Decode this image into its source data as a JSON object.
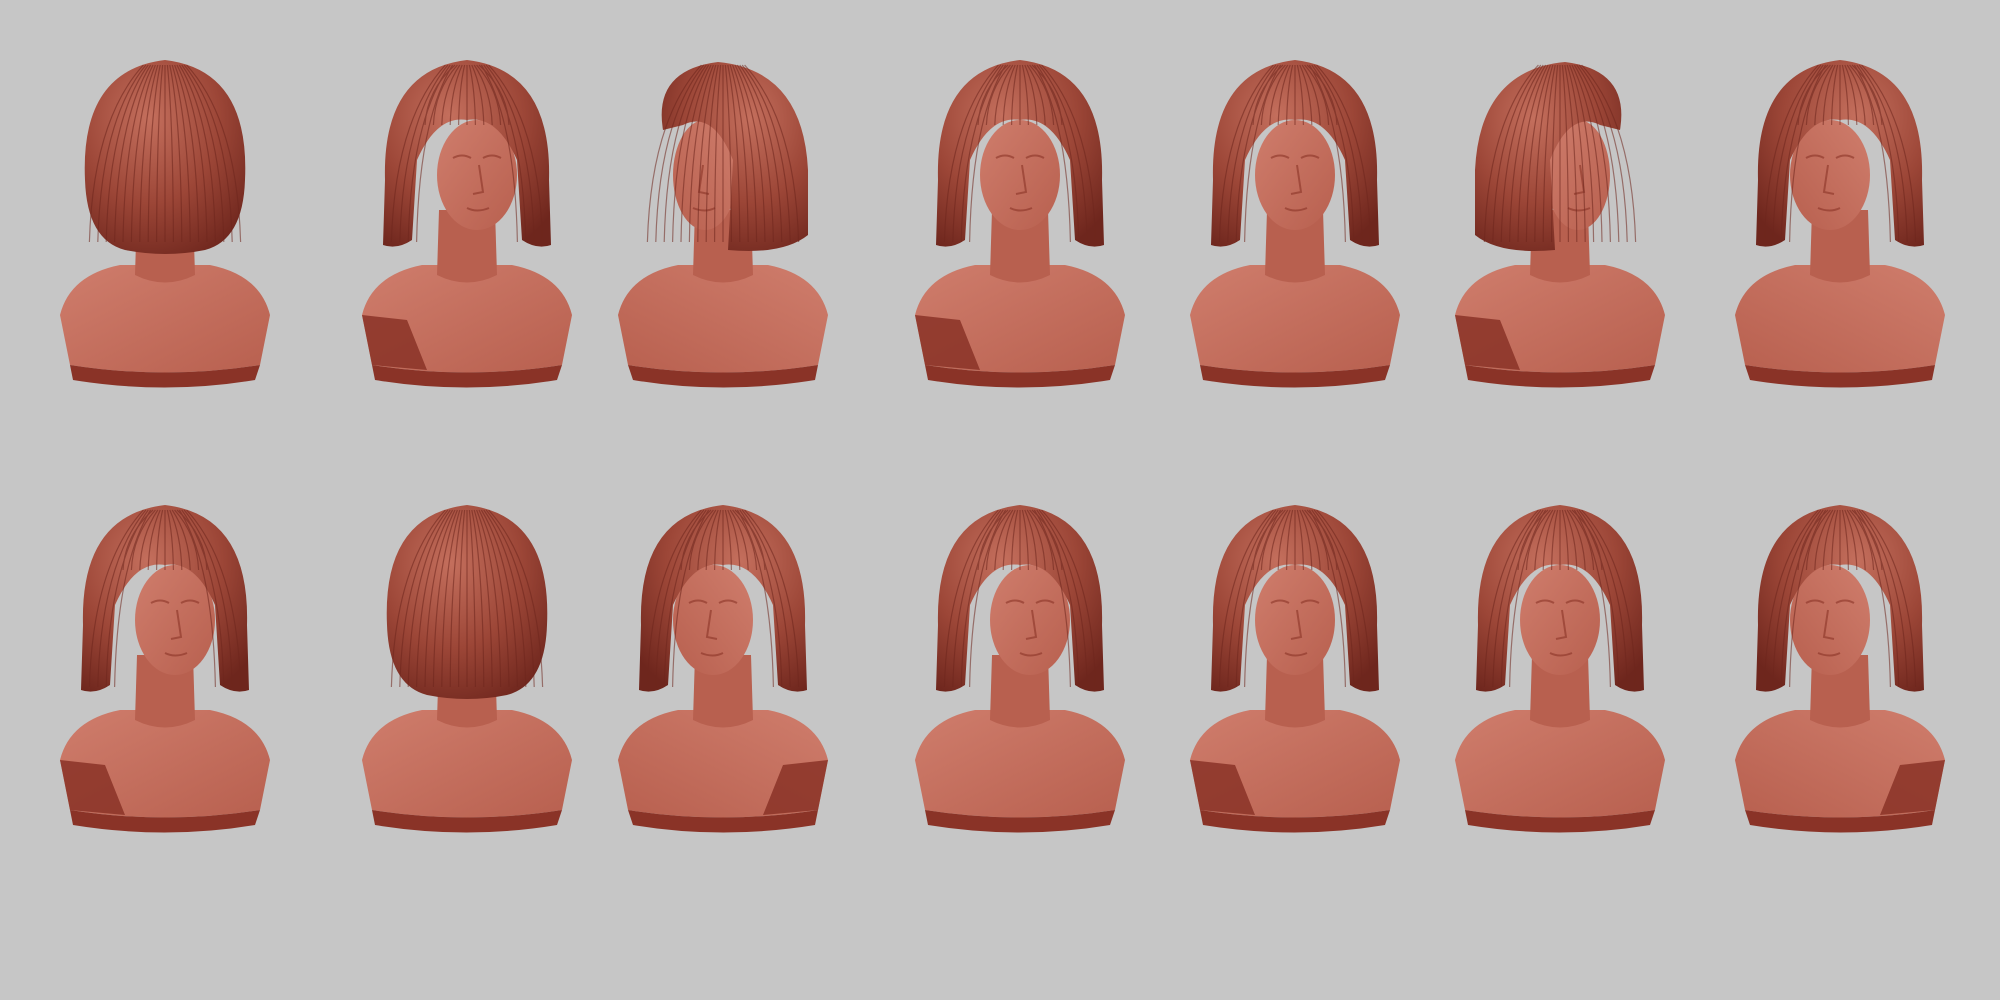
{
  "scene": {
    "background_color": "#c6c6c6",
    "clay_colors": {
      "skin_light": "#cf7d6c",
      "skin_mid": "#b8604f",
      "skin_dark": "#8a3327",
      "hair": "#9c4637",
      "hair_dark": "#6e261d",
      "hair_light": "#c46f5d"
    },
    "rows": [
      {
        "views": [
          {
            "view": "back-left",
            "angle": 200
          },
          {
            "view": "three-quarter-right",
            "angle": 30
          },
          {
            "view": "profile-left",
            "angle": -90
          },
          {
            "view": "front-up",
            "angle": 0
          },
          {
            "view": "front",
            "angle": 0
          },
          {
            "view": "back-right-profile",
            "angle": 120
          },
          {
            "view": "three-quarter-left-tilted",
            "angle": -40
          }
        ]
      },
      {
        "views": [
          {
            "view": "three-quarter-right",
            "angle": 35
          },
          {
            "view": "back-top",
            "angle": 180
          },
          {
            "view": "three-quarter-left",
            "angle": -35
          },
          {
            "view": "three-quarter-right-down",
            "angle": 25
          },
          {
            "view": "front",
            "angle": 0
          },
          {
            "view": "top-down",
            "angle": 10
          },
          {
            "view": "three-quarter-left",
            "angle": -20
          }
        ]
      }
    ]
  }
}
